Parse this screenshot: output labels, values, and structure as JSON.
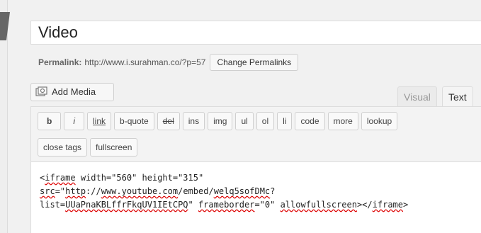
{
  "title": {
    "value": "Video"
  },
  "permalink": {
    "label": "Permalink:",
    "url": "http://www.i.surahman.co/?p=57",
    "button": "Change Permalinks"
  },
  "media": {
    "add_label": "Add Media"
  },
  "tabs": {
    "visual": "Visual",
    "text": "Text"
  },
  "quicktags": {
    "row1": [
      "b",
      "i",
      "link",
      "b-quote",
      "del",
      "ins",
      "img",
      "ul",
      "ol",
      "li",
      "code",
      "more",
      "lookup"
    ],
    "row2": [
      "close tags",
      "fullscreen"
    ]
  },
  "content": {
    "line1": {
      "p1": "<",
      "p2": "iframe",
      "p3": " width=\"560\" height=\"315\""
    },
    "line2": {
      "p1": "src",
      "p2": "=\"",
      "p3": "http",
      "p4": "://",
      "p5": "www.youtube.com",
      "p6": "/embed/",
      "p7": "welq5sofDMc",
      "p8": "?"
    },
    "line3": {
      "p1": "list=",
      "p2": "UUaPnaKBLffrFkqUV1IEtCPQ",
      "p3": "\" ",
      "p4": "frameborder",
      "p5": "=\"0\" ",
      "p6": "allowfullscreen",
      "p7": "></",
      "p8": "iframe",
      "p9": ">"
    }
  }
}
